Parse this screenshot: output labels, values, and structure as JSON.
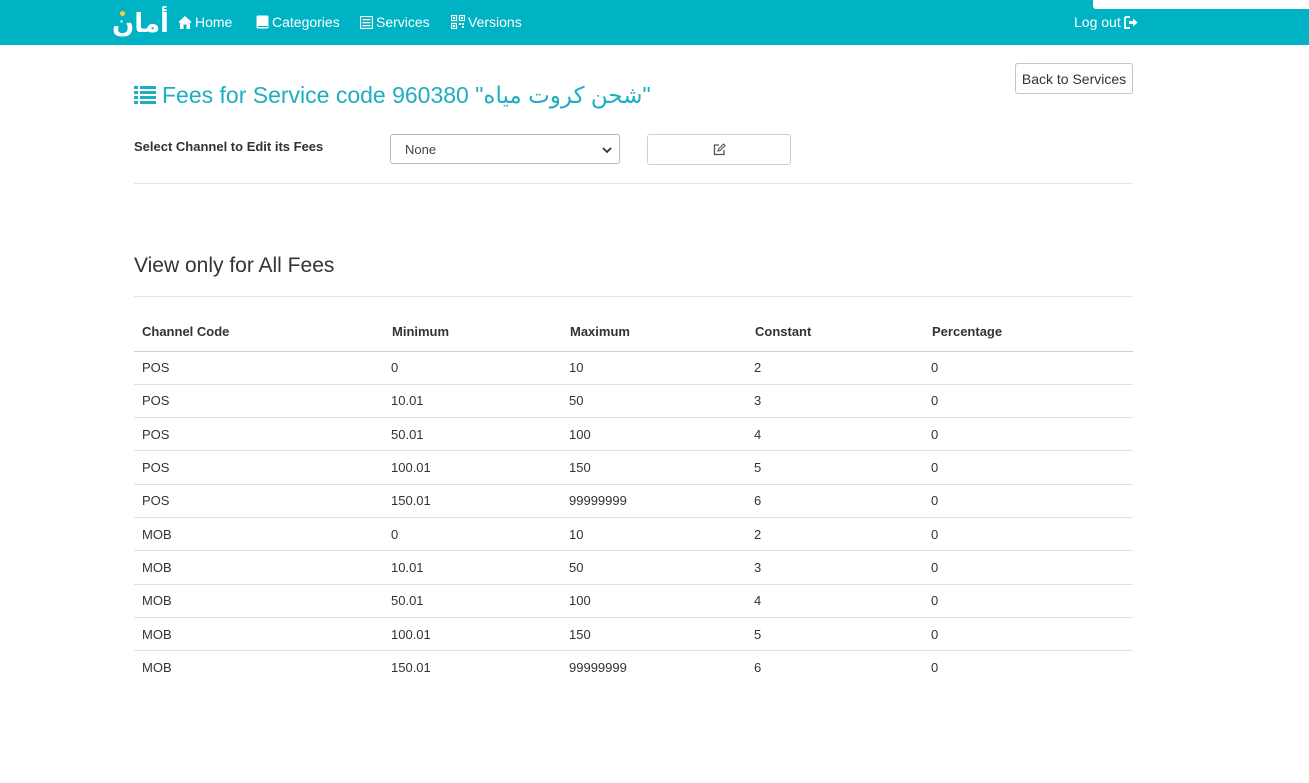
{
  "nav": {
    "brand": "أمان",
    "items": [
      {
        "label": "Home",
        "icon": "home-icon"
      },
      {
        "label": "Categories",
        "icon": "book-icon"
      },
      {
        "label": "Services",
        "icon": "list-icon"
      },
      {
        "label": "Versions",
        "icon": "qrcode-icon"
      }
    ],
    "logout": "Log out",
    "background": "#00b3c4"
  },
  "page": {
    "title": "Fees for Service code 960380 \"شحن كروت مياه\"",
    "back_button": "Back to Services",
    "select_label": "Select Channel to Edit its Fees",
    "channel_select": {
      "value": "None"
    },
    "section_title": "View only for All Fees",
    "accent_color": "#1eaec0"
  },
  "table": {
    "headers": [
      "Channel Code",
      "Minimum",
      "Maximum",
      "Constant",
      "Percentage"
    ],
    "rows": [
      [
        "POS",
        "0",
        "10",
        "2",
        "0"
      ],
      [
        "POS",
        "10.01",
        "50",
        "3",
        "0"
      ],
      [
        "POS",
        "50.01",
        "100",
        "4",
        "0"
      ],
      [
        "POS",
        "100.01",
        "150",
        "5",
        "0"
      ],
      [
        "POS",
        "150.01",
        "99999999",
        "6",
        "0"
      ],
      [
        "MOB",
        "0",
        "10",
        "2",
        "0"
      ],
      [
        "MOB",
        "10.01",
        "50",
        "3",
        "0"
      ],
      [
        "MOB",
        "50.01",
        "100",
        "4",
        "0"
      ],
      [
        "MOB",
        "100.01",
        "150",
        "5",
        "0"
      ],
      [
        "MOB",
        "150.01",
        "99999999",
        "6",
        "0"
      ]
    ]
  }
}
